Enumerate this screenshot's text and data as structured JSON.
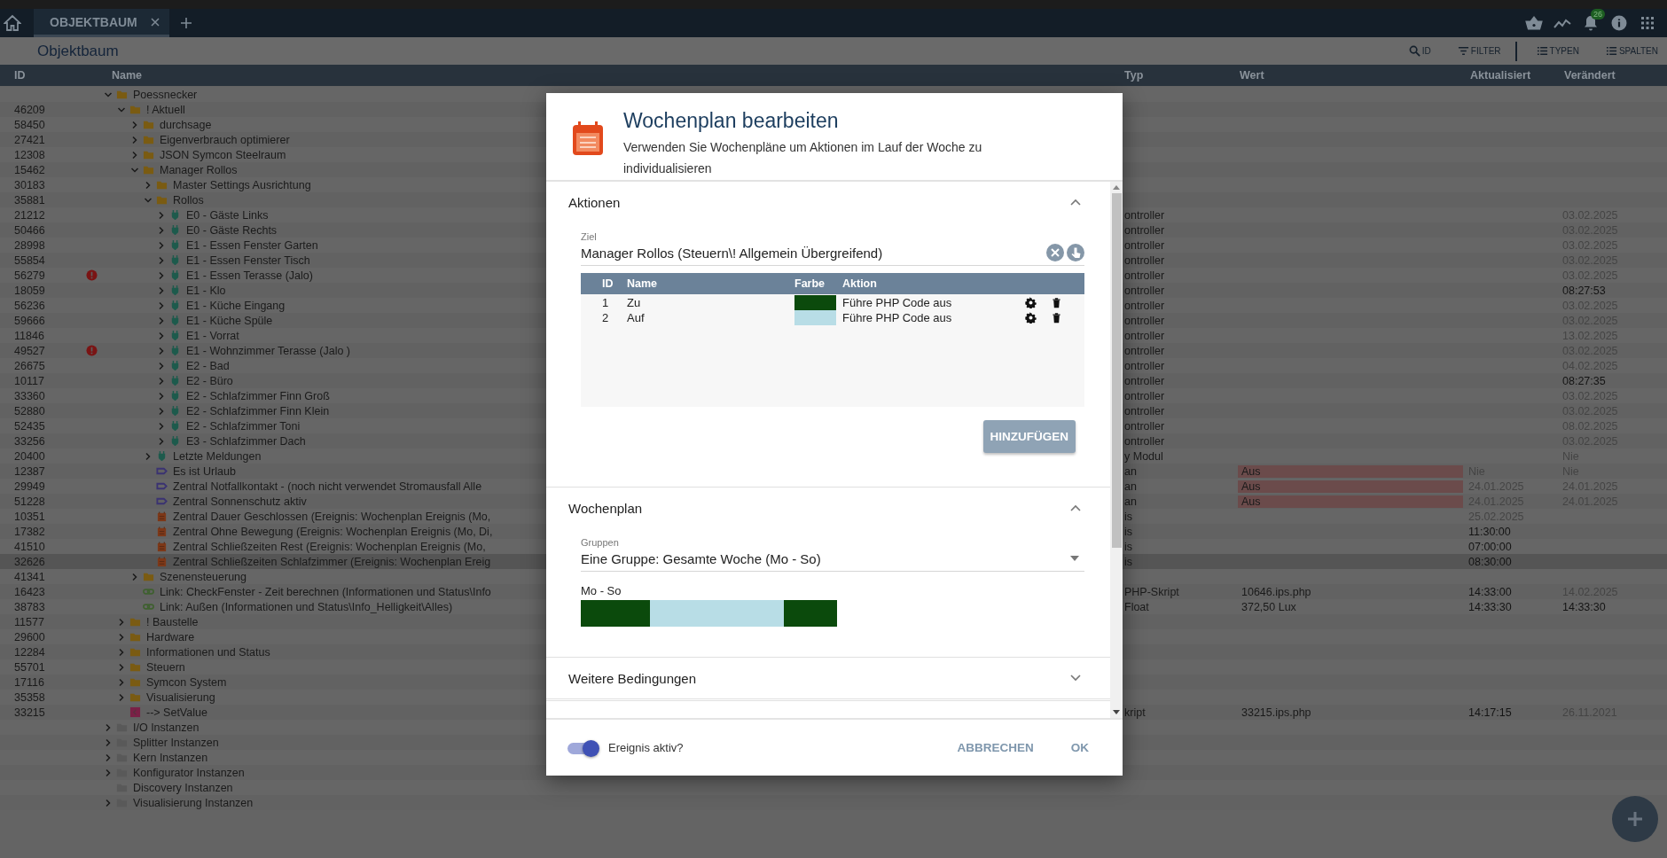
{
  "topbar": {
    "tabs": [
      {
        "label": "OBJEKTBAUM",
        "selected": true
      }
    ],
    "notification_count": "26"
  },
  "page": {
    "title": "Objektbaum",
    "tool_groups": [
      [
        {
          "label": "ID",
          "kind": "search"
        },
        {
          "label": "FILTER",
          "kind": "filter"
        }
      ],
      [
        {
          "label": "TYPEN",
          "kind": "list"
        },
        {
          "label": "SPALTEN",
          "kind": "list"
        }
      ]
    ]
  },
  "columns": [
    "ID",
    "Name",
    "Typ",
    "Wert",
    "Aktualisiert",
    "Verändert"
  ],
  "tree": [
    {
      "name": "Poessnecker",
      "kind": "folder",
      "expanded": true,
      "error": false,
      "selected": false,
      "children": [
        {
          "id": "46209",
          "name": "! Aktuell",
          "kind": "folder",
          "expanded": true,
          "error": false,
          "selected": false,
          "children": [
            {
              "id": "58450",
              "name": "durchsage",
              "kind": "folder",
              "expanded": false,
              "error": false,
              "selected": false
            },
            {
              "id": "27421",
              "name": "Eigenverbrauch optimierer",
              "kind": "folder",
              "expanded": false,
              "error": false,
              "selected": false
            },
            {
              "id": "12308",
              "name": "JSON Symcon Steelraum",
              "kind": "folder",
              "expanded": false,
              "error": false,
              "selected": false
            },
            {
              "id": "15462",
              "name": "Manager Rollos",
              "kind": "folder",
              "expanded": true,
              "error": false,
              "selected": false,
              "children": [
                {
                  "id": "30183",
                  "name": "Master Settings Ausrichtung",
                  "kind": "folder",
                  "expanded": false,
                  "error": false,
                  "selected": false
                },
                {
                  "id": "35881",
                  "name": "Rollos",
                  "kind": "folder",
                  "expanded": true,
                  "error": false,
                  "selected": false,
                  "children": [
                    {
                      "id": "21212",
                      "name": "E0 - Gäste Links",
                      "kind": "instance",
                      "expanded": false,
                      "error": false,
                      "selected": false,
                      "typ": "ontroller",
                      "veraendert": {
                        "text": "03.02.2025",
                        "recent": false
                      }
                    },
                    {
                      "id": "50466",
                      "name": "E0 - Gäste Rechts",
                      "kind": "instance",
                      "expanded": false,
                      "error": false,
                      "selected": false,
                      "typ": "ontroller",
                      "veraendert": {
                        "text": "03.02.2025",
                        "recent": false
                      }
                    },
                    {
                      "id": "28998",
                      "name": "E1 - Essen Fenster Garten",
                      "kind": "instance",
                      "expanded": false,
                      "error": false,
                      "selected": false,
                      "typ": "ontroller",
                      "veraendert": {
                        "text": "03.02.2025",
                        "recent": false
                      }
                    },
                    {
                      "id": "55854",
                      "name": "E1 - Essen Fenster Tisch",
                      "kind": "instance",
                      "expanded": false,
                      "error": false,
                      "selected": false,
                      "typ": "ontroller",
                      "veraendert": {
                        "text": "03.02.2025",
                        "recent": false
                      }
                    },
                    {
                      "id": "56279",
                      "name": "E1 - Essen Terasse (Jalo)",
                      "kind": "instance",
                      "expanded": false,
                      "error": true,
                      "selected": false,
                      "typ": "ontroller",
                      "veraendert": {
                        "text": "03.02.2025",
                        "recent": false
                      }
                    },
                    {
                      "id": "18059",
                      "name": "E1 - Klo",
                      "kind": "instance",
                      "expanded": false,
                      "error": false,
                      "selected": false,
                      "typ": "ontroller",
                      "veraendert": {
                        "text": "08:27:53",
                        "recent": true
                      }
                    },
                    {
                      "id": "56236",
                      "name": "E1 - Küche Eingang",
                      "kind": "instance",
                      "expanded": false,
                      "error": false,
                      "selected": false,
                      "typ": "ontroller",
                      "veraendert": {
                        "text": "03.02.2025",
                        "recent": false
                      }
                    },
                    {
                      "id": "59666",
                      "name": "E1 - Küche Spüle",
                      "kind": "instance",
                      "expanded": false,
                      "error": false,
                      "selected": false,
                      "typ": "ontroller",
                      "veraendert": {
                        "text": "03.02.2025",
                        "recent": false
                      }
                    },
                    {
                      "id": "11846",
                      "name": "E1 - Vorrat",
                      "kind": "instance",
                      "expanded": false,
                      "error": false,
                      "selected": false,
                      "typ": "ontroller",
                      "veraendert": {
                        "text": "13.02.2025",
                        "recent": false
                      }
                    },
                    {
                      "id": "49527",
                      "name": "E1 - Wohnzimmer Terasse (Jalo )",
                      "kind": "instance",
                      "expanded": false,
                      "error": true,
                      "selected": false,
                      "typ": "ontroller",
                      "veraendert": {
                        "text": "03.02.2025",
                        "recent": false
                      }
                    },
                    {
                      "id": "26675",
                      "name": "E2 - Bad",
                      "kind": "instance",
                      "expanded": false,
                      "error": false,
                      "selected": false,
                      "typ": "ontroller",
                      "veraendert": {
                        "text": "04.02.2025",
                        "recent": false
                      }
                    },
                    {
                      "id": "10117",
                      "name": "E2 - Büro",
                      "kind": "instance",
                      "expanded": false,
                      "error": false,
                      "selected": false,
                      "typ": "ontroller",
                      "veraendert": {
                        "text": "08:27:35",
                        "recent": true
                      }
                    },
                    {
                      "id": "33360",
                      "name": "E2 - Schlafzimmer Finn Groß",
                      "kind": "instance",
                      "expanded": false,
                      "error": false,
                      "selected": false,
                      "typ": "ontroller",
                      "veraendert": {
                        "text": "03.02.2025",
                        "recent": false
                      }
                    },
                    {
                      "id": "52880",
                      "name": "E2 - Schlafzimmer Finn Klein",
                      "kind": "instance",
                      "expanded": false,
                      "error": false,
                      "selected": false,
                      "typ": "ontroller",
                      "veraendert": {
                        "text": "03.02.2025",
                        "recent": false
                      }
                    },
                    {
                      "id": "52435",
                      "name": "E2 - Schlafzimmer Toni",
                      "kind": "instance",
                      "expanded": false,
                      "error": false,
                      "selected": false,
                      "typ": "ontroller",
                      "veraendert": {
                        "text": "08.02.2025",
                        "recent": false
                      }
                    },
                    {
                      "id": "33256",
                      "name": "E3 - Schlafzimmer Dach",
                      "kind": "instance",
                      "expanded": false,
                      "error": false,
                      "selected": false,
                      "typ": "ontroller",
                      "veraendert": {
                        "text": "03.02.2025",
                        "recent": false
                      }
                    }
                  ]
                },
                {
                  "id": "20400",
                  "name": "Letzte Meldungen",
                  "kind": "instance",
                  "expanded": false,
                  "error": false,
                  "selected": false,
                  "typ": "y Modul",
                  "veraendert": {
                    "text": "Nie",
                    "recent": false
                  }
                },
                {
                  "id": "12387",
                  "name": "Es ist Urlaub",
                  "kind": "variable",
                  "error": false,
                  "selected": false,
                  "typ": "an",
                  "wert": {
                    "text": "Aus",
                    "highlighted": true
                  },
                  "aktualisiert": {
                    "text": "Nie",
                    "recent": false
                  },
                  "veraendert": {
                    "text": "Nie",
                    "recent": false
                  }
                },
                {
                  "id": "29949",
                  "name": "Zentral Notfallkontakt - (noch nicht verwendet Stromausfall Alle",
                  "kind": "variable",
                  "error": false,
                  "selected": false,
                  "typ": "an",
                  "wert": {
                    "text": "Aus",
                    "highlighted": true
                  },
                  "aktualisiert": {
                    "text": "24.01.2025",
                    "recent": false
                  },
                  "veraendert": {
                    "text": "24.01.2025",
                    "recent": false
                  }
                },
                {
                  "id": "51228",
                  "name": "Zentral Sonnenschutz aktiv",
                  "kind": "variable",
                  "error": false,
                  "selected": false,
                  "typ": "an",
                  "wert": {
                    "text": "Aus",
                    "highlighted": true
                  },
                  "aktualisiert": {
                    "text": "24.01.2025",
                    "recent": false
                  },
                  "veraendert": {
                    "text": "24.01.2025",
                    "recent": false
                  }
                },
                {
                  "id": "10351",
                  "name": "Zentral Dauer Geschlossen (Ereignis: Wochenplan Ereignis (Mo,",
                  "kind": "event",
                  "error": false,
                  "selected": false,
                  "typ": "is",
                  "aktualisiert": {
                    "text": "25.02.2025",
                    "recent": false
                  }
                },
                {
                  "id": "17382",
                  "name": "Zentral Ohne Bewegung (Ereignis: Wochenplan Ereignis (Mo, Di,",
                  "kind": "event",
                  "error": false,
                  "selected": false,
                  "typ": "is",
                  "aktualisiert": {
                    "text": "11:30:00",
                    "recent": true
                  }
                },
                {
                  "id": "41510",
                  "name": "Zentral Schließzeiten Rest (Ereignis: Wochenplan Ereignis (Mo,",
                  "kind": "event",
                  "error": false,
                  "selected": false,
                  "typ": "is",
                  "aktualisiert": {
                    "text": "07:00:00",
                    "recent": true
                  }
                },
                {
                  "id": "32626",
                  "name": "Zentral Schließzeiten Schlafzimmer (Ereignis: Wochenplan Ereig",
                  "kind": "event",
                  "error": false,
                  "selected": true,
                  "typ": "is",
                  "aktualisiert": {
                    "text": "08:30:00",
                    "recent": true
                  }
                }
              ]
            },
            {
              "id": "41341",
              "name": "Szenensteuerung",
              "kind": "folder",
              "expanded": false,
              "error": false,
              "selected": false
            },
            {
              "id": "16423",
              "name": "Link: CheckFenster - Zeit berechnen (Informationen und Status\\Info",
              "kind": "link",
              "error": false,
              "selected": false,
              "typ": "PHP-Skript",
              "wert": {
                "text": "10646.ips.php",
                "highlighted": false
              },
              "aktualisiert": {
                "text": "14:33:00",
                "recent": true
              },
              "veraendert": {
                "text": "14.02.2025",
                "recent": false
              }
            },
            {
              "id": "38783",
              "name": "Link: Außen (Informationen und Status\\Info_Helligkeit\\Alles)",
              "kind": "link",
              "error": false,
              "selected": false,
              "typ": "Float",
              "wert": {
                "text": "372,50 Lux",
                "highlighted": false
              },
              "aktualisiert": {
                "text": "14:33:30",
                "recent": true
              },
              "veraendert": {
                "text": "14:33:30",
                "recent": true
              }
            }
          ]
        },
        {
          "id": "11577",
          "name": "! Baustelle",
          "kind": "folder",
          "expanded": false,
          "error": false,
          "selected": false
        },
        {
          "id": "29600",
          "name": "Hardware",
          "kind": "folder",
          "expanded": false,
          "error": false,
          "selected": false
        },
        {
          "id": "12284",
          "name": "Informationen und Status",
          "kind": "folder",
          "expanded": false,
          "error": false,
          "selected": false
        },
        {
          "id": "55701",
          "name": "Steuern",
          "kind": "folder",
          "expanded": false,
          "error": false,
          "selected": false
        },
        {
          "id": "17116",
          "name": "Symcon System",
          "kind": "folder",
          "expanded": false,
          "error": false,
          "selected": false
        },
        {
          "id": "35358",
          "name": "Visualisierung",
          "kind": "folder",
          "expanded": false,
          "error": false,
          "selected": false
        },
        {
          "id": "33215",
          "name": "--> SetValue",
          "kind": "script",
          "error": false,
          "selected": false,
          "typ": "kript",
          "wert": {
            "text": "33215.ips.php",
            "highlighted": false
          },
          "aktualisiert": {
            "text": "14:17:15",
            "recent": true
          },
          "veraendert": {
            "text": "26.11.2021",
            "recent": false
          }
        }
      ]
    },
    {
      "name": "I/O Instanzen",
      "kind": "system-folder",
      "expanded": false,
      "error": false,
      "selected": false
    },
    {
      "name": "Splitter Instanzen",
      "kind": "system-folder",
      "expanded": false,
      "error": false,
      "selected": false
    },
    {
      "name": "Kern Instanzen",
      "kind": "system-folder",
      "expanded": false,
      "error": false,
      "selected": false
    },
    {
      "name": "Konfigurator Instanzen",
      "kind": "system-folder",
      "expanded": false,
      "error": false,
      "selected": false
    },
    {
      "name": "Discovery Instanzen",
      "kind": "system-folder",
      "error": false,
      "selected": false
    },
    {
      "name": "Visualisierung Instanzen",
      "kind": "system-folder",
      "expanded": false,
      "error": false,
      "selected": false
    }
  ],
  "dialog": {
    "title": "Wochenplan bearbeiten",
    "subtitle": "Verwenden Sie Wochenpläne um Aktionen im Lauf der Woche zu individualisieren",
    "sections": [
      {
        "kind": "actions",
        "title": "Aktionen",
        "expanded": true,
        "target": {
          "label": "Ziel",
          "value": "Manager Rollos (Steuern\\! Allgemein Übergreifend)"
        },
        "table": {
          "columns": [
            "ID",
            "Name",
            "Farbe",
            "Aktion"
          ],
          "rows": [
            {
              "id": "1",
              "name": "Zu",
              "color": "#0b4a0c",
              "action": "Führe PHP Code aus"
            },
            {
              "id": "2",
              "name": "Auf",
              "color": "#b8dde6",
              "action": "Führe PHP Code aus"
            }
          ]
        },
        "add_button": "HINZUFÜGEN"
      },
      {
        "kind": "schedule",
        "title": "Wochenplan",
        "expanded": true,
        "groups": {
          "label": "Gruppen",
          "value": "Eine Gruppe: Gesamte Woche (Mo - So)"
        },
        "days": [
          {
            "label": "Mo - So"
          }
        ]
      },
      {
        "kind": "conditions",
        "title": "Weitere Bedingungen",
        "expanded": false
      }
    ],
    "active": {
      "label": "Ereignis aktiv?",
      "on": true
    },
    "buttons": [
      "ABBRECHEN",
      "OK"
    ]
  }
}
